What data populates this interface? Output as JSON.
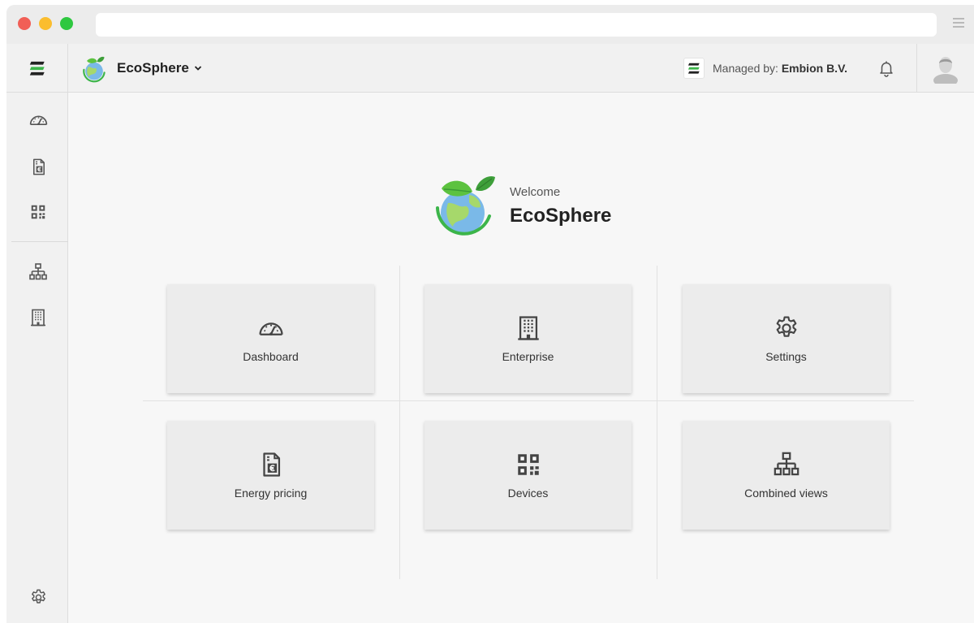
{
  "header": {
    "app_name": "EcoSphere",
    "managed_prefix": "Managed by:",
    "managed_company": "Embion B.V."
  },
  "welcome": {
    "greeting": "Welcome",
    "title": "EcoSphere"
  },
  "sidebar": {
    "items": [
      {
        "icon": "dashboard-icon"
      },
      {
        "icon": "energy-pricing-icon"
      },
      {
        "icon": "devices-icon"
      },
      {
        "icon": "combined-views-icon"
      },
      {
        "icon": "enterprise-icon"
      },
      {
        "icon": "settings-icon"
      }
    ]
  },
  "tiles": [
    {
      "label": "Dashboard",
      "icon": "dashboard-icon"
    },
    {
      "label": "Enterprise",
      "icon": "enterprise-icon"
    },
    {
      "label": "Settings",
      "icon": "settings-icon"
    },
    {
      "label": "Energy pricing",
      "icon": "energy-pricing-icon"
    },
    {
      "label": "Devices",
      "icon": "devices-icon"
    },
    {
      "label": "Combined views",
      "icon": "combined-views-icon"
    }
  ],
  "colors": {
    "brand_green": "#3cb54a",
    "leaf_green": "#5cc23f",
    "globe_blue": "#7ab9e8",
    "icon_gray": "#555555"
  }
}
